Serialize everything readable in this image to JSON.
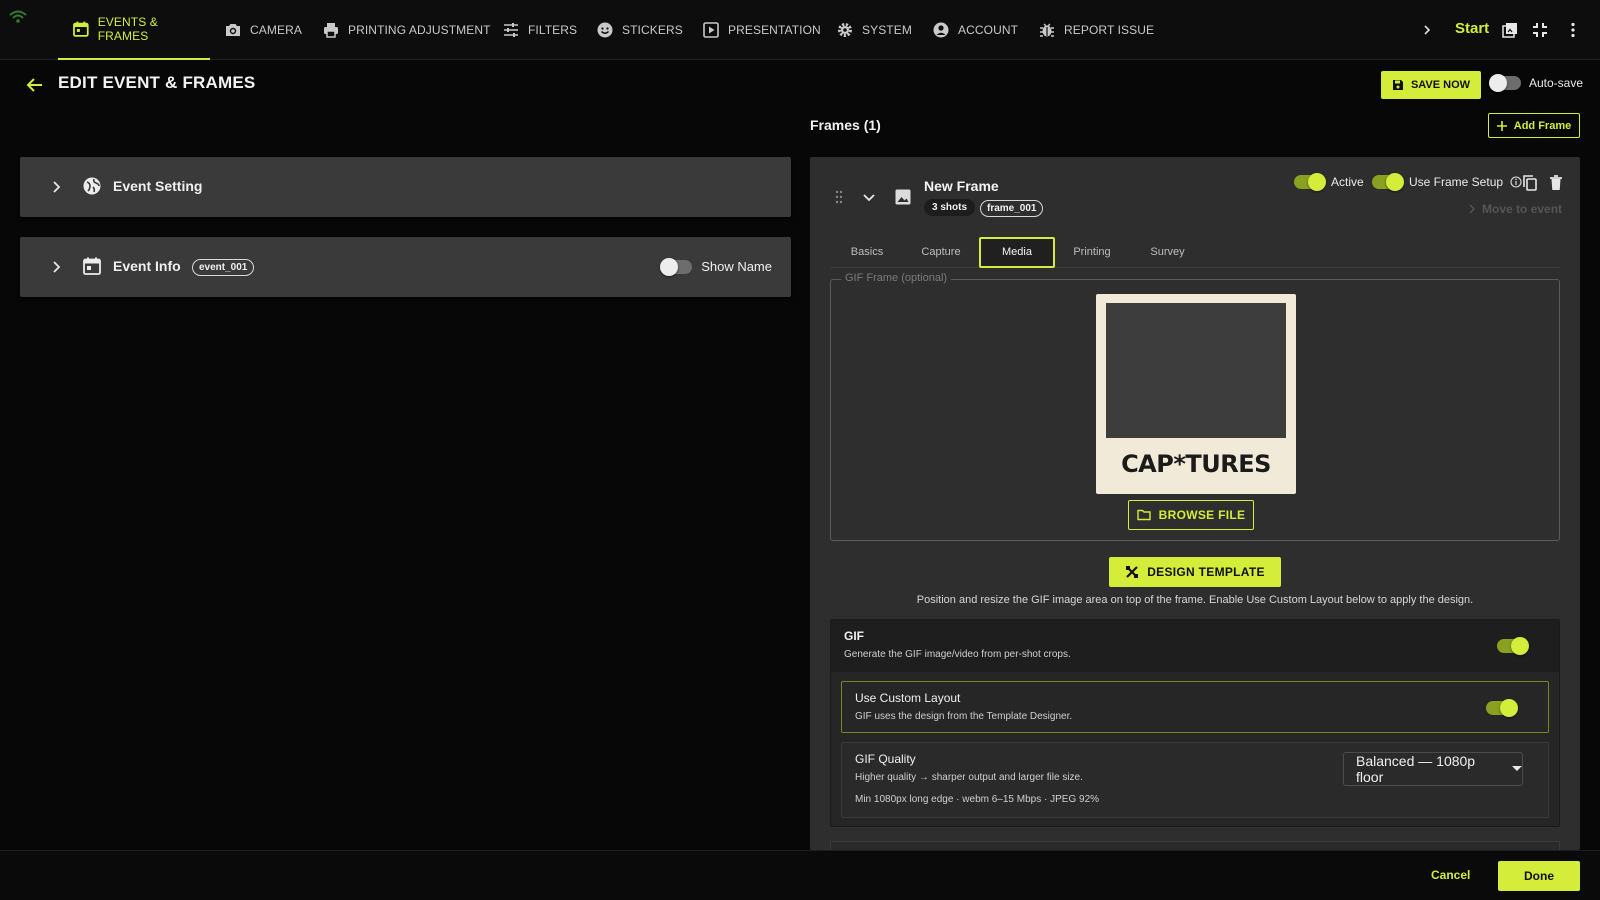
{
  "nav": {
    "tabs": [
      {
        "label": "EVENTS & FRAMES",
        "icon": "calendar-icon"
      },
      {
        "label": "CAMERA",
        "icon": "camera-icon"
      },
      {
        "label": "PRINTING ADJUSTMENT",
        "icon": "printer-icon"
      },
      {
        "label": "FILTERS",
        "icon": "sliders-icon"
      },
      {
        "label": "STICKERS",
        "icon": "smiley-icon"
      },
      {
        "label": "PRESENTATION",
        "icon": "play-icon"
      },
      {
        "label": "SYSTEM",
        "icon": "gear-icon"
      },
      {
        "label": "ACCOUNT",
        "icon": "user-icon"
      },
      {
        "label": "REPORT ISSUE",
        "icon": "bug-icon"
      }
    ],
    "start_label": "Start",
    "accent_color": "#d4ec3a"
  },
  "header": {
    "title": "EDIT EVENT & FRAMES",
    "save_now": "SAVE NOW",
    "autosave_label": "Auto-save",
    "autosave_on": false
  },
  "left": {
    "event_setting": "Event Setting",
    "event_info": "Event Info",
    "event_info_id": "event_001",
    "show_name_label": "Show Name",
    "show_name_on": false
  },
  "frames": {
    "title": "Frames (1)",
    "add_label": "Add Frame",
    "frame": {
      "name": "New Frame",
      "shots": "3 shots",
      "id": "frame_001",
      "active_label": "Active",
      "active_on": true,
      "use_frame_setup_label": "Use Frame Setup",
      "use_frame_setup_on": true,
      "move_label": "Move to event"
    },
    "tabs": [
      "Basics",
      "Capture",
      "Media",
      "Printing",
      "Survey"
    ],
    "active_tab": "Media",
    "gif_frame_legend": "GIF Frame (optional)",
    "preview_brand": "CAP*TURES",
    "browse_label": "BROWSE FILE",
    "design_label": "DESIGN TEMPLATE",
    "design_help": "Position and resize the GIF image area on top of the frame. Enable Use Custom Layout below to apply the design.",
    "gif": {
      "title": "GIF",
      "desc": "Generate the GIF image/video from per-shot crops.",
      "on": true
    },
    "custom_layout": {
      "title": "Use Custom Layout",
      "desc": "GIF uses the design from the Template Designer.",
      "on": true
    },
    "quality": {
      "title": "GIF Quality",
      "desc": "Higher quality → sharper output and larger file size.",
      "spec": "Min 1080px long edge · webm 6–15 Mbps · JPEG 92%",
      "selected": "Balanced — 1080p floor"
    }
  },
  "footer": {
    "cancel": "Cancel",
    "done": "Done"
  }
}
